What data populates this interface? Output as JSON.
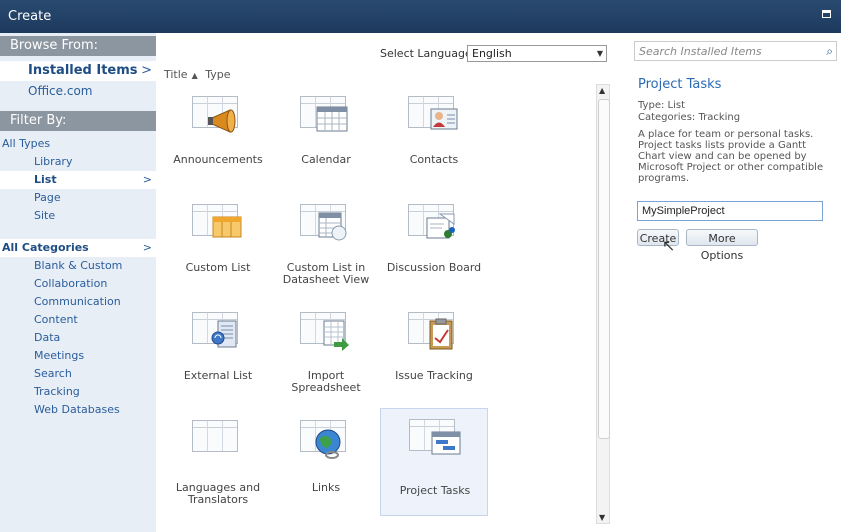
{
  "window": {
    "title": "Create",
    "close_label": "x"
  },
  "sidebar": {
    "browse_heading": "Browse From:",
    "browse_items": [
      {
        "label": "Installed Items",
        "selected": true
      },
      {
        "label": "Office.com",
        "selected": false
      }
    ],
    "filter_heading": "Filter By:",
    "type_items": [
      {
        "label": "All Types"
      },
      {
        "label": "Library"
      },
      {
        "label": "List",
        "selected": true
      },
      {
        "label": "Page"
      },
      {
        "label": "Site"
      }
    ],
    "category_items": [
      {
        "label": "All Categories",
        "selected": true
      },
      {
        "label": "Blank & Custom"
      },
      {
        "label": "Collaboration"
      },
      {
        "label": "Communication"
      },
      {
        "label": "Content"
      },
      {
        "label": "Data"
      },
      {
        "label": "Meetings"
      },
      {
        "label": "Search"
      },
      {
        "label": "Tracking"
      },
      {
        "label": "Web Databases"
      }
    ],
    "chevron": ">"
  },
  "language": {
    "label": "Select Language:",
    "value": "English"
  },
  "sort": {
    "title": "Title",
    "arrow": "▲",
    "type": "Type"
  },
  "templates": [
    {
      "label": "Announcements",
      "icon": "megaphone-icon"
    },
    {
      "label": "Calendar",
      "icon": "calendar-icon"
    },
    {
      "label": "Contacts",
      "icon": "contact-card-icon"
    },
    {
      "label": "Custom List",
      "icon": "custom-list-icon"
    },
    {
      "label": "Custom List in Datasheet View",
      "icon": "datasheet-icon"
    },
    {
      "label": "Discussion Board",
      "icon": "discussion-icon"
    },
    {
      "label": "External List",
      "icon": "external-list-icon"
    },
    {
      "label": "Import Spreadsheet",
      "icon": "spreadsheet-icon"
    },
    {
      "label": "Issue Tracking",
      "icon": "clipboard-icon"
    },
    {
      "label": "Languages and Translators",
      "icon": "languages-icon"
    },
    {
      "label": "Links",
      "icon": "globe-link-icon"
    },
    {
      "label": "Project Tasks",
      "icon": "gantt-icon",
      "selected": true
    }
  ],
  "search": {
    "placeholder": "Search Installed Items"
  },
  "detail": {
    "title": "Project Tasks",
    "type": "Type: List",
    "categories": "Categories: Tracking",
    "description": "A place for team or personal tasks. Project tasks lists provide a Gantt Chart view and can be opened by Microsoft Project or other compatible programs.",
    "name_value": "MySimpleProject",
    "create_label": "Create",
    "more_label": "More Options"
  },
  "colors": {
    "titlebar": "#1d3a5e",
    "link": "#2a5d9b",
    "heading": "#8c96a1",
    "sidebar_bg": "#e8eef6"
  }
}
